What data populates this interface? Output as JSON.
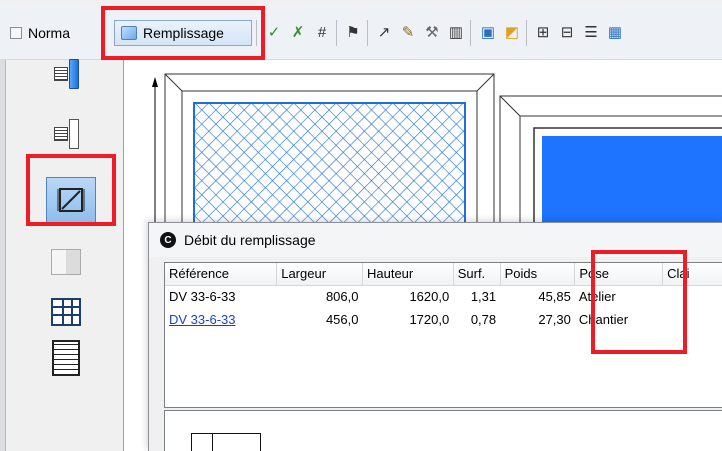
{
  "toolbar": {
    "normal_label": "Norma",
    "remplissage_label": "Remplissage",
    "icons": [
      "check-edit-icon",
      "check-cross-icon",
      "hash-grid-icon",
      "flag-icon",
      "arrow-tool-icon",
      "pencil-tool-icon",
      "hammer-icon",
      "columns-icon",
      "screen-icon",
      "image-icon",
      "split-icon",
      "merge-icon",
      "align-icon",
      "table-icon"
    ]
  },
  "left_panel": {
    "tools": [
      "grid-fill-icon",
      "grid-empty-icon",
      "resize-frame-icon",
      "double-leaf-icon",
      "mullion-grid-icon",
      "blinds-icon"
    ]
  },
  "dialog": {
    "title": "Débit du remplissage",
    "columns": [
      "Référence",
      "Largeur",
      "Hauteur",
      "Surf.",
      "Poids",
      "Pose",
      "Clai"
    ],
    "rows": [
      {
        "reference": "DV 33-6-33",
        "largeur": "806,0",
        "hauteur": "1620,0",
        "surf": "1,31",
        "poids": "45,85",
        "pose": "Atelier"
      },
      {
        "reference": "DV 33-6-33",
        "largeur": "456,0",
        "hauteur": "1720,0",
        "surf": "0,78",
        "poids": "27,30",
        "pose": "Chantier"
      }
    ]
  },
  "colors": {
    "highlight": "#ee1c24",
    "glass_blue": "#1e73ff",
    "hatch_blue": "#1d6fe0",
    "link": "#1a3fd6"
  }
}
